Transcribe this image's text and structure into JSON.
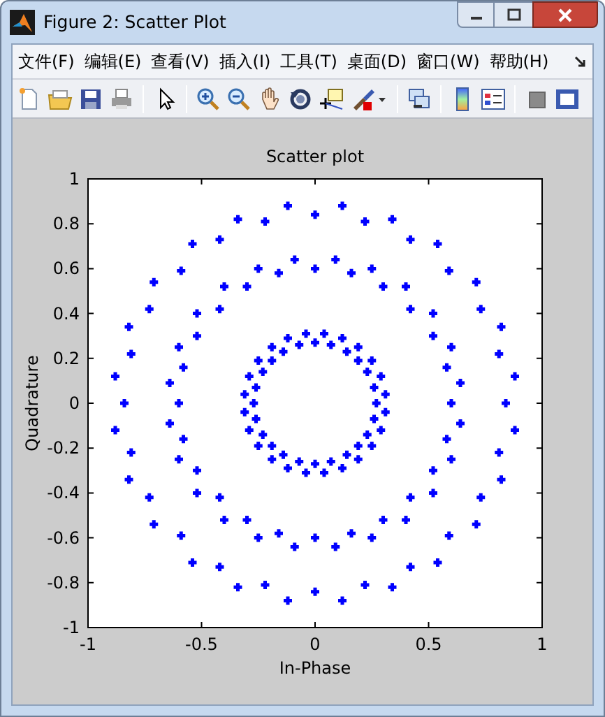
{
  "window": {
    "title": "Figure 2: Scatter Plot"
  },
  "menu": [
    {
      "label": "文件(F)"
    },
    {
      "label": "编辑(E)"
    },
    {
      "label": "查看(V)"
    },
    {
      "label": "插入(I)"
    },
    {
      "label": "工具(T)"
    },
    {
      "label": "桌面(D)"
    },
    {
      "label": "窗口(W)"
    },
    {
      "label": "帮助(H)"
    }
  ],
  "figure": {
    "chart_data": {
      "type": "scatter",
      "title": "Scatter plot",
      "xlabel": "In-Phase",
      "ylabel": "Quadrature",
      "xlim": [
        -1,
        1
      ],
      "ylim": [
        -1,
        1
      ],
      "xticks": [
        -1,
        -0.5,
        0,
        0.5,
        1
      ],
      "yticks": [
        -1,
        -0.8,
        -0.6,
        -0.4,
        -0.2,
        0,
        0.2,
        0.4,
        0.6,
        0.8,
        1
      ],
      "series": [
        {
          "color": "#0000ff",
          "x": [
            0.84,
            0.88,
            0.81,
            0.82,
            0.73,
            0.71,
            0.59,
            0.54,
            0.42,
            0.34,
            0.22,
            0.12,
            0,
            -0.12,
            -0.22,
            -0.34,
            -0.42,
            -0.54,
            -0.59,
            -0.71,
            -0.73,
            -0.82,
            -0.81,
            -0.88,
            -0.84,
            -0.88,
            -0.81,
            -0.82,
            -0.73,
            -0.71,
            -0.59,
            -0.54,
            -0.42,
            -0.34,
            -0.22,
            -0.12,
            0,
            0.12,
            0.22,
            0.34,
            0.42,
            0.54,
            0.59,
            0.71,
            0.73,
            0.82,
            0.81,
            0.88
          ],
          "values": [
            0,
            0.12,
            0.22,
            0.34,
            0.42,
            0.54,
            0.59,
            0.71,
            0.73,
            0.82,
            0.81,
            0.88,
            0.84,
            0.88,
            0.81,
            0.82,
            0.73,
            0.71,
            0.59,
            0.54,
            0.42,
            0.34,
            0.22,
            0.12,
            0,
            -0.12,
            -0.22,
            -0.34,
            -0.42,
            -0.54,
            -0.59,
            -0.71,
            -0.73,
            -0.82,
            -0.81,
            -0.88,
            -0.84,
            -0.88,
            -0.81,
            -0.82,
            -0.73,
            -0.71,
            -0.59,
            -0.54,
            -0.42,
            -0.34,
            -0.22,
            -0.12
          ]
        },
        {
          "color": "#0000ff",
          "x": [
            0.6,
            0.64,
            0.58,
            0.6,
            0.52,
            0.52,
            0.42,
            0.4,
            0.3,
            0.25,
            0.16,
            0.09,
            0,
            -0.09,
            -0.16,
            -0.25,
            -0.3,
            -0.4,
            -0.42,
            -0.52,
            -0.52,
            -0.6,
            -0.58,
            -0.64,
            -0.6,
            -0.64,
            -0.58,
            -0.6,
            -0.52,
            -0.52,
            -0.42,
            -0.4,
            -0.3,
            -0.25,
            -0.16,
            -0.09,
            0,
            0.09,
            0.16,
            0.25,
            0.3,
            0.4,
            0.42,
            0.52,
            0.52,
            0.6,
            0.58,
            0.64
          ],
          "values": [
            0,
            0.09,
            0.16,
            0.25,
            0.3,
            0.4,
            0.42,
            0.52,
            0.52,
            0.6,
            0.58,
            0.64,
            0.6,
            0.64,
            0.58,
            0.6,
            0.52,
            0.52,
            0.42,
            0.4,
            0.3,
            0.25,
            0.16,
            0.09,
            0,
            -0.09,
            -0.16,
            -0.25,
            -0.3,
            -0.4,
            -0.42,
            -0.52,
            -0.52,
            -0.6,
            -0.58,
            -0.64,
            -0.6,
            -0.64,
            -0.58,
            -0.6,
            -0.52,
            -0.52,
            -0.42,
            -0.4,
            -0.3,
            -0.25,
            -0.16,
            -0.09
          ]
        },
        {
          "color": "#0000ff",
          "x": [
            0.27,
            0.31,
            0.26,
            0.29,
            0.23,
            0.25,
            0.19,
            0.19,
            0.14,
            0.12,
            0.07,
            0.04,
            0,
            -0.04,
            -0.07,
            -0.12,
            -0.14,
            -0.19,
            -0.19,
            -0.25,
            -0.23,
            -0.29,
            -0.26,
            -0.31,
            -0.27,
            -0.31,
            -0.26,
            -0.29,
            -0.23,
            -0.25,
            -0.19,
            -0.19,
            -0.14,
            -0.12,
            -0.07,
            -0.04,
            0,
            0.04,
            0.07,
            0.12,
            0.14,
            0.19,
            0.19,
            0.25,
            0.23,
            0.29,
            0.26,
            0.31
          ],
          "values": [
            0,
            0.04,
            0.07,
            0.12,
            0.14,
            0.19,
            0.19,
            0.25,
            0.23,
            0.29,
            0.26,
            0.31,
            0.27,
            0.31,
            0.26,
            0.29,
            0.23,
            0.25,
            0.19,
            0.19,
            0.14,
            0.12,
            0.07,
            0.04,
            0,
            -0.04,
            -0.07,
            -0.12,
            -0.14,
            -0.19,
            -0.19,
            -0.25,
            -0.23,
            -0.29,
            -0.26,
            -0.31,
            -0.27,
            -0.31,
            -0.26,
            -0.29,
            -0.23,
            -0.25,
            -0.19,
            -0.19,
            -0.14,
            -0.12,
            -0.07,
            -0.04
          ]
        }
      ]
    }
  }
}
